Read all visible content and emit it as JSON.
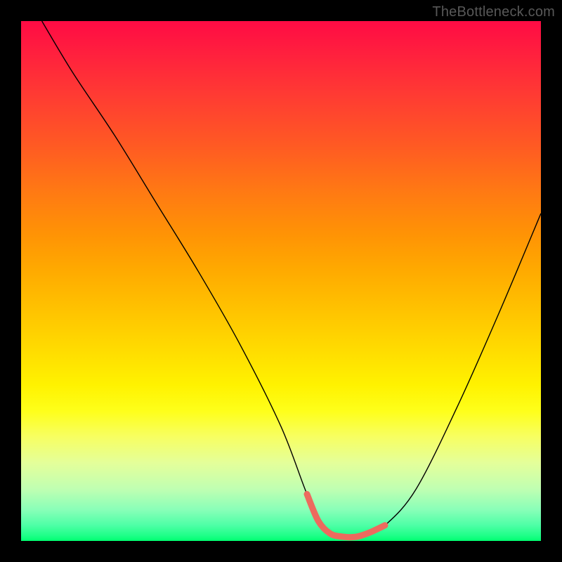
{
  "attribution": "TheBottleneck.com",
  "chart_data": {
    "type": "line",
    "title": "",
    "xlabel": "",
    "ylabel": "",
    "xlim": [
      0,
      100
    ],
    "ylim": [
      0,
      100
    ],
    "series": [
      {
        "name": "black-curve",
        "color": "#000000",
        "width": 1.4,
        "x": [
          4,
          10,
          18,
          26,
          34,
          42,
          50,
          55,
          58,
          62,
          66,
          70,
          76,
          84,
          92,
          100
        ],
        "y": [
          100,
          90,
          78,
          65,
          52,
          38,
          22,
          9,
          3,
          1,
          1,
          3,
          10,
          26,
          44,
          63
        ]
      },
      {
        "name": "highlight-band",
        "color": "#ed6a5e",
        "width": 9,
        "x": [
          55,
          57.2,
          59.5,
          62,
          64.5,
          67,
          70
        ],
        "y": [
          9,
          3.8,
          1.4,
          0.8,
          0.8,
          1.6,
          3
        ]
      }
    ],
    "gradient_stops": [
      {
        "pct": 0,
        "color": "#ff0b44"
      },
      {
        "pct": 14,
        "color": "#ff3a33"
      },
      {
        "pct": 33,
        "color": "#ff7a13"
      },
      {
        "pct": 48,
        "color": "#ffaa00"
      },
      {
        "pct": 63,
        "color": "#ffdb00"
      },
      {
        "pct": 75,
        "color": "#feff1a"
      },
      {
        "pct": 90,
        "color": "#c0ffb2"
      },
      {
        "pct": 100,
        "color": "#00ff70"
      }
    ]
  }
}
